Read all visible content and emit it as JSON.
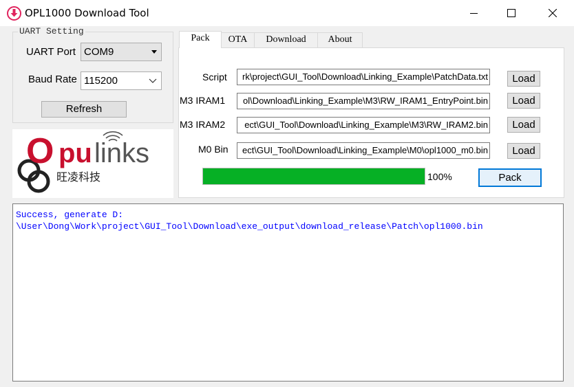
{
  "window": {
    "title": "OPL1000 Download Tool",
    "controls": [
      "minimize-icon",
      "maximize-icon",
      "close-icon"
    ]
  },
  "uart": {
    "group_title": "UART Setting",
    "port_label": "UART Port",
    "port_value": "COM9",
    "baud_label": "Baud Rate",
    "baud_value": "115200",
    "refresh_label": "Refresh"
  },
  "logo": {
    "text_o": "O",
    "text_pu": "pu",
    "text_links": "links",
    "chinese": "旺凌科技",
    "brand_red": "#c8102e",
    "brand_gray": "#555555"
  },
  "tabs": [
    {
      "label": "Pack",
      "active": true
    },
    {
      "label": "OTA",
      "active": false
    },
    {
      "label": "Download",
      "active": false
    },
    {
      "label": "About",
      "active": false
    }
  ],
  "pack": {
    "rows": [
      {
        "label": "Script",
        "value": "rk\\project\\GUI_Tool\\Download\\Linking_Example\\PatchData.txt",
        "button": "Load"
      },
      {
        "label": "M3 IRAM1",
        "value": "ol\\Download\\Linking_Example\\M3\\RW_IRAM1_EntryPoint.bin",
        "button": "Load"
      },
      {
        "label": "M3 IRAM2",
        "value": "ect\\GUI_Tool\\Download\\Linking_Example\\M3\\RW_IRAM2.bin",
        "button": "Load"
      },
      {
        "label": "M0 Bin",
        "value": "ect\\GUI_Tool\\Download\\Linking_Example\\M0\\opl1000_m0.bin",
        "button": "Load"
      }
    ],
    "progress_percent": 100,
    "progress_text": "100%",
    "pack_button": "Pack",
    "progress_color": "#06b025"
  },
  "log": {
    "lines": [
      "Success, generate D:",
      "\\User\\Dong\\Work\\project\\GUI_Tool\\Download\\exe_output\\download_release\\Patch\\opl1000.bin"
    ],
    "color": "#0000ff"
  }
}
